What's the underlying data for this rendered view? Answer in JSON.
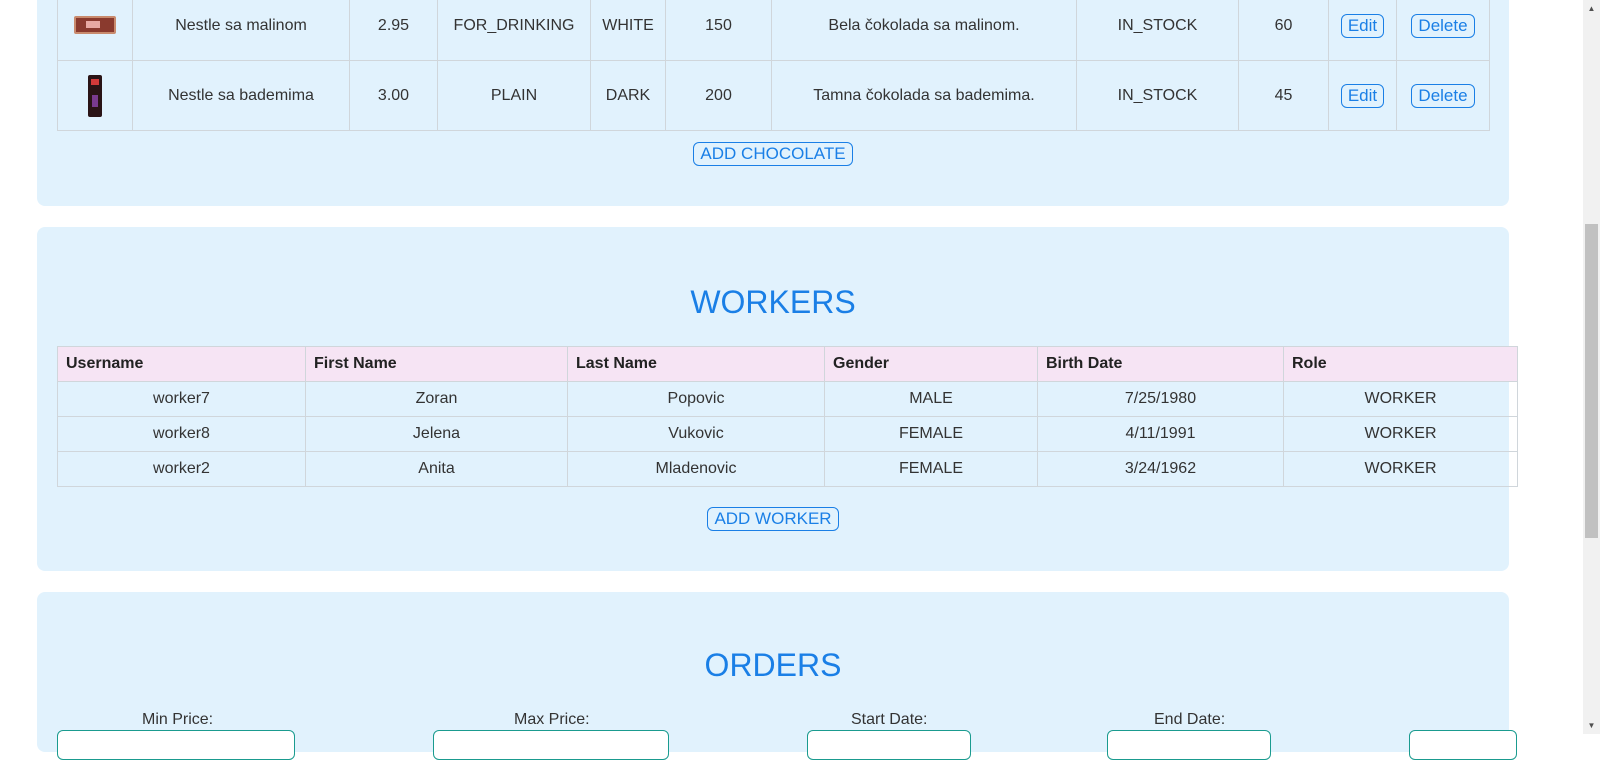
{
  "chocolates": {
    "rows": [
      {
        "name": "Nestle sa malinom",
        "price": "2.95",
        "category": "FOR_DRINKING",
        "type": "WHITE",
        "weight": "150",
        "description": "Bela čokolada sa malinom.",
        "status": "IN_STOCK",
        "quantity": "60",
        "edit_label": "Edit",
        "delete_label": "Delete"
      },
      {
        "name": "Nestle sa bademima",
        "price": "3.00",
        "category": "PLAIN",
        "type": "DARK",
        "weight": "200",
        "description": "Tamna čokolada sa bademima.",
        "status": "IN_STOCK",
        "quantity": "45",
        "edit_label": "Edit",
        "delete_label": "Delete"
      }
    ],
    "add_label": "ADD CHOCOLATE"
  },
  "workers": {
    "title": "WORKERS",
    "columns": [
      "Username",
      "First Name",
      "Last Name",
      "Gender",
      "Birth Date",
      "Role"
    ],
    "rows": [
      [
        "worker7",
        "Zoran",
        "Popovic",
        "MALE",
        "7/25/1980",
        "WORKER"
      ],
      [
        "worker8",
        "Jelena",
        "Vukovic",
        "FEMALE",
        "4/11/1991",
        "WORKER"
      ],
      [
        "worker2",
        "Anita",
        "Mladenovic",
        "FEMALE",
        "3/24/1962",
        "WORKER"
      ]
    ],
    "add_label": "ADD WORKER"
  },
  "orders": {
    "title": "ORDERS",
    "filters": {
      "min_price_label": "Min Price:",
      "max_price_label": "Max Price:",
      "start_date_label": "Start Date:",
      "end_date_label": "End Date:"
    }
  },
  "colors": {
    "accent": "#1a7fe6",
    "panel": "#e1f2fd",
    "header_row": "#f6e4f4"
  }
}
